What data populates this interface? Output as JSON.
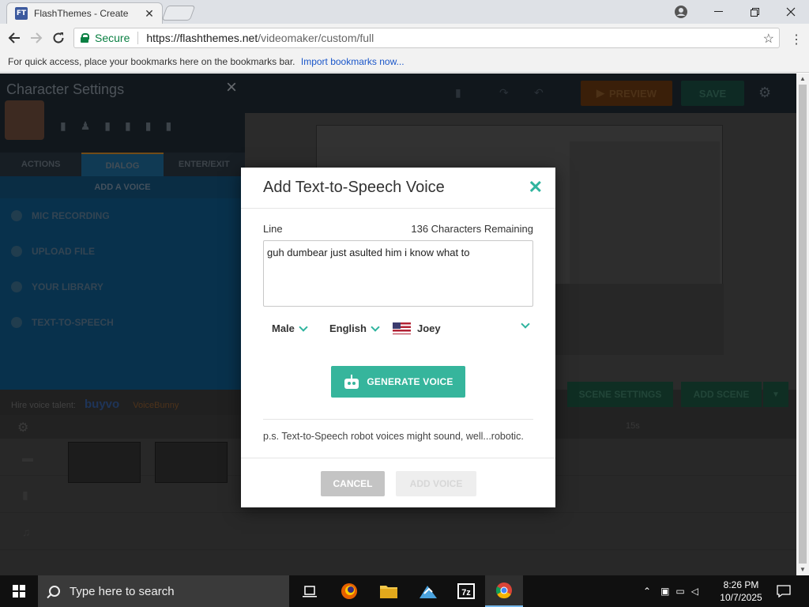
{
  "browser": {
    "tab_title": "FlashThemes - Create",
    "tab_favicon_text": "FT",
    "tab_close": "✕",
    "secure_label": "Secure",
    "url_host": "https://flashthemes.net",
    "url_path": "/videomaker/custom/full",
    "bookmarks_prompt": "For quick access, place your bookmarks here on the bookmarks bar.",
    "bookmarks_link": "Import bookmarks now..."
  },
  "left_panel": {
    "title": "Character Settings",
    "tabs": [
      "ACTIONS",
      "DIALOG",
      "ENTER/EXIT"
    ],
    "section": "ADD A VOICE",
    "items": [
      "MIC RECORDING",
      "UPLOAD FILE",
      "YOUR LIBRARY",
      "TEXT-TO-SPEECH"
    ],
    "hire_label": "Hire voice talent:",
    "brand1": "buyvo",
    "brand2": "VoiceBunny"
  },
  "toolbar": {
    "preview_label": "PREVIEW",
    "save_label": "SAVE"
  },
  "stage": {
    "scene_settings_label": "SCENE SETTINGS",
    "add_scene_label": "ADD SCENE",
    "timeline_label": "15s"
  },
  "modal": {
    "title": "Add Text-to-Speech Voice",
    "line_label": "Line",
    "remaining": "136 Characters Remaining",
    "line_value": "guh dumbear just asulted him i know what to",
    "gender": "Male",
    "language": "English",
    "voice": "Joey",
    "generate_label": "GENERATE VOICE",
    "note": "p.s. Text-to-Speech robot voices might sound, well...robotic.",
    "cancel_label": "CANCEL",
    "add_voice_label": "ADD VOICE"
  },
  "taskbar": {
    "search_placeholder": "Type here to search",
    "time": "8:26 PM",
    "date": "10/7/2025"
  },
  "colors": {
    "accent": "#36b59c",
    "secure_green": "#0b8043",
    "link_blue": "#1a56c9"
  }
}
